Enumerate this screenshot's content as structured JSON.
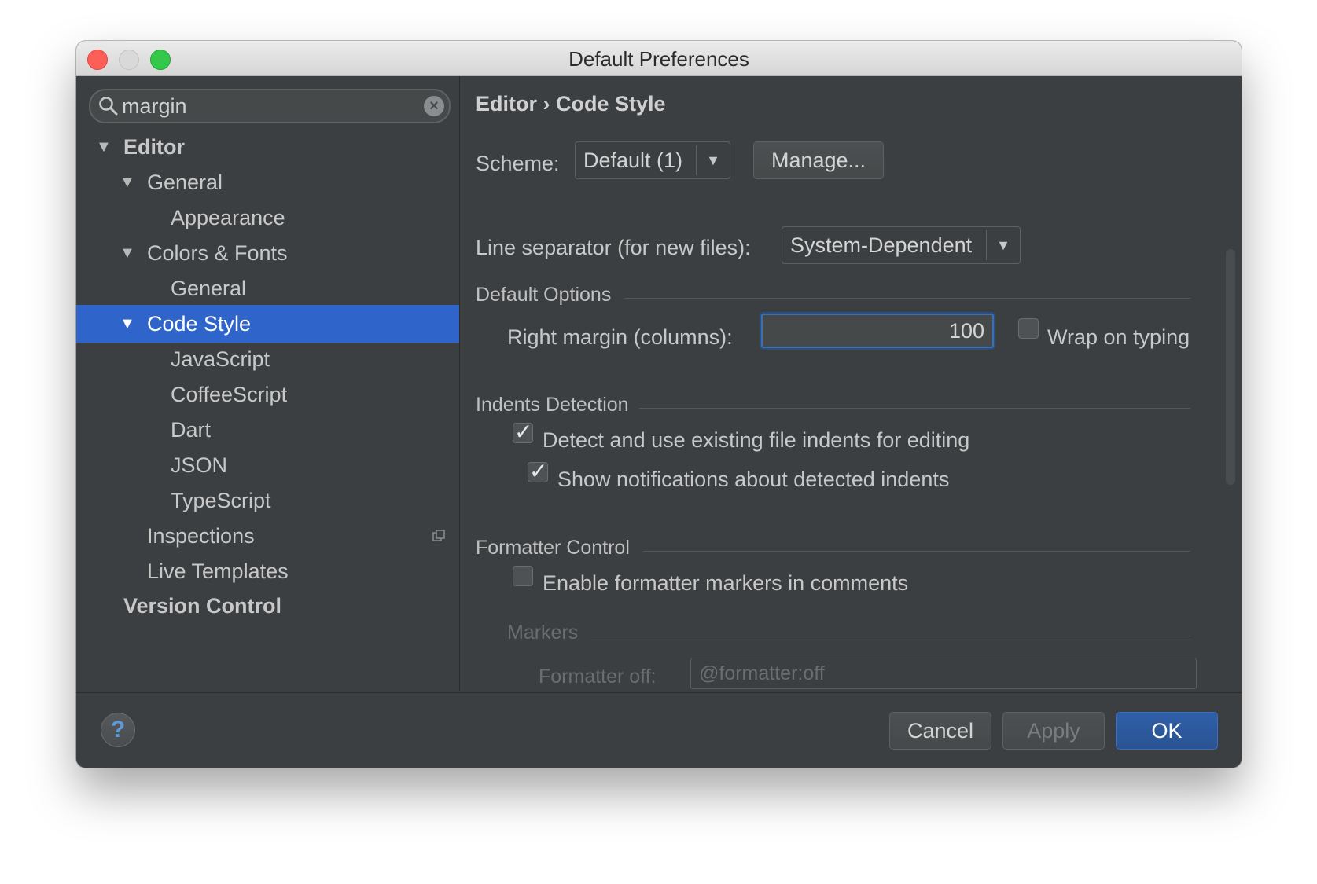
{
  "window": {
    "title": "Default Preferences"
  },
  "search": {
    "value": "margin"
  },
  "tree": [
    {
      "label": "Editor",
      "bold": true,
      "expanded": true
    },
    {
      "label": "General",
      "expanded": true
    },
    {
      "label": "Appearance"
    },
    {
      "label": "Colors & Fonts",
      "expanded": true
    },
    {
      "label": "General"
    },
    {
      "label": "Code Style",
      "expanded": true,
      "selected": true
    },
    {
      "label": "JavaScript"
    },
    {
      "label": "CoffeeScript"
    },
    {
      "label": "Dart"
    },
    {
      "label": "JSON"
    },
    {
      "label": "TypeScript"
    },
    {
      "label": "Inspections"
    },
    {
      "label": "Live Templates"
    },
    {
      "label": "Version Control",
      "bold": true
    }
  ],
  "main": {
    "breadcrumb": {
      "part1": "Editor",
      "sep": "›",
      "part2": "Code Style"
    },
    "scheme": {
      "label": "Scheme:",
      "value": "Default (1)",
      "manage": "Manage..."
    },
    "line_separator": {
      "label": "Line separator (for new files):",
      "value": "System-Dependent"
    },
    "default_options": {
      "title": "Default Options",
      "right_margin_label": "Right margin (columns):",
      "right_margin_value": "100",
      "wrap_on_typing": {
        "label": "Wrap on typing",
        "checked": false
      }
    },
    "indents_detection": {
      "title": "Indents Detection",
      "detect": {
        "label": "Detect and use existing file indents for editing",
        "checked": true
      },
      "notify": {
        "label": "Show notifications about detected indents",
        "checked": true
      }
    },
    "formatter_control": {
      "title": "Formatter Control",
      "enable": {
        "label": "Enable formatter markers in comments",
        "checked": false
      },
      "markers_title": "Markers",
      "formatter_off_label": "Formatter off:",
      "formatter_off_value": "@formatter:off"
    }
  },
  "footer": {
    "help": "?",
    "cancel": "Cancel",
    "apply": "Apply",
    "ok": "OK"
  },
  "colors": {
    "selection": "#2f65ca",
    "panel": "#3c3f41",
    "ok_button": "#2f5fa8"
  }
}
